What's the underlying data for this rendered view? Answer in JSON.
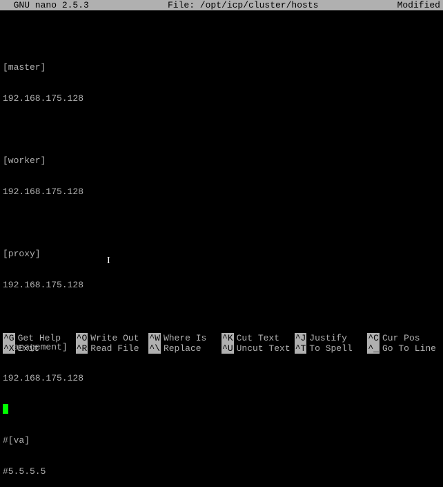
{
  "titlebar": {
    "app": "  GNU nano 2.5.3",
    "file": "File: /opt/icp/cluster/hosts",
    "status": "Modified"
  },
  "lines": {
    "l0": "",
    "l1": "[master]",
    "l2": "192.168.175.128",
    "l3": "",
    "l4": "[worker]",
    "l5": "192.168.175.128",
    "l6": "",
    "l7": "[proxy]",
    "l8": "192.168.175.128",
    "l9": "",
    "l10": "[management]",
    "l11": "192.168.175.128",
    "l12cursor": "",
    "l13": "#[va]",
    "l14": "#5.5.5.5"
  },
  "shortcuts": {
    "r1": {
      "k0": "^G",
      "t0": "Get Help",
      "k1": "^O",
      "t1": "Write Out",
      "k2": "^W",
      "t2": "Where Is",
      "k3": "^K",
      "t3": "Cut Text",
      "k4": "^J",
      "t4": "Justify",
      "k5": "^C",
      "t5": "Cur Pos"
    },
    "r2": {
      "k0": "^X",
      "t0": "Exit",
      "k1": "^R",
      "t1": "Read File",
      "k2": "^\\",
      "t2": "Replace",
      "k3": "^U",
      "t3": "Uncut Text",
      "k4": "^T",
      "t4": "To Spell",
      "k5": "^_",
      "t5": "Go To Line"
    }
  }
}
